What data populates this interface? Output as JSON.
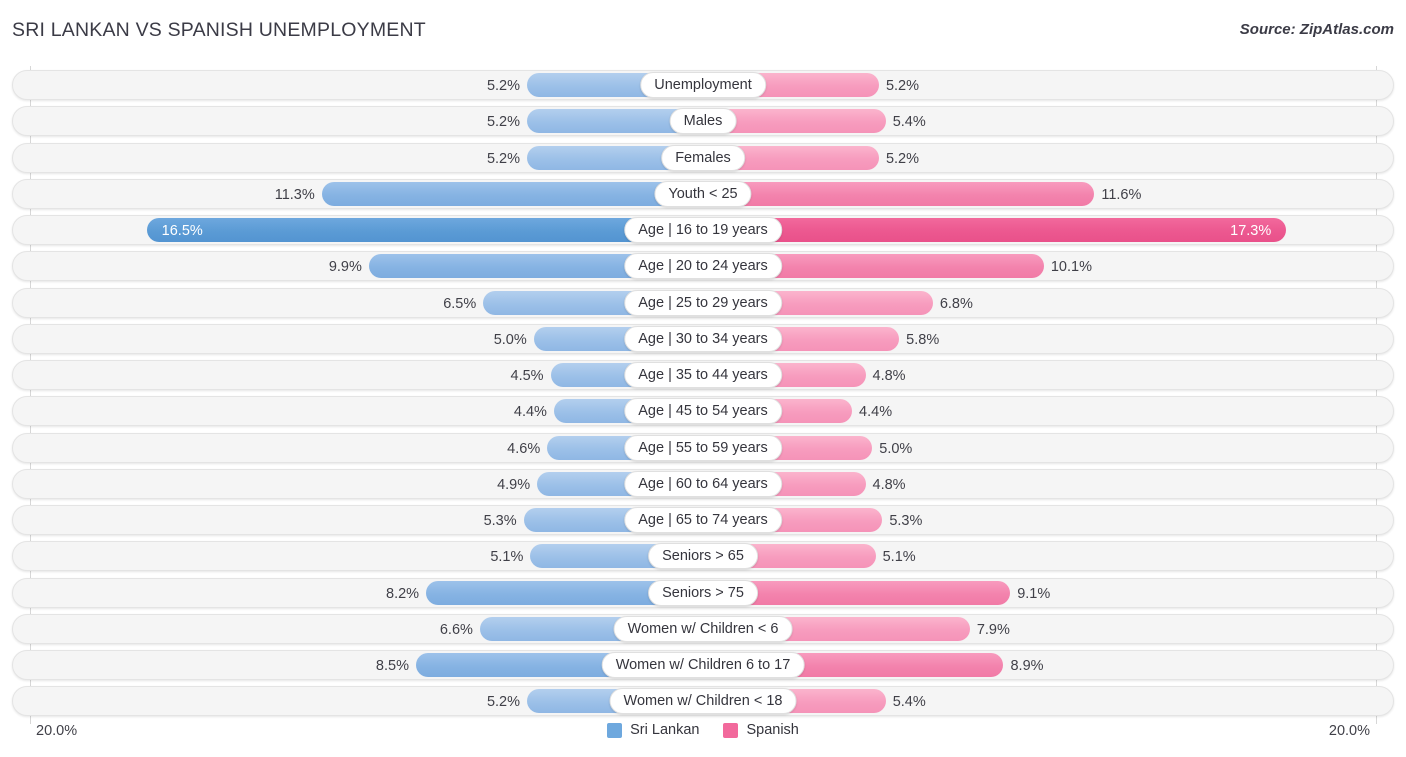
{
  "header": {
    "title": "SRI LANKAN VS SPANISH UNEMPLOYMENT",
    "source": "Source: ZipAtlas.com"
  },
  "axis": {
    "left_max_label": "20.0%",
    "right_max_label": "20.0%"
  },
  "legend": {
    "items": [
      {
        "label": "Sri Lankan",
        "color": "#6ea8de"
      },
      {
        "label": "Spanish",
        "color": "#f2699c"
      }
    ]
  },
  "chart_data": {
    "type": "bar",
    "orientation": "horizontal-diverging",
    "title": "SRI LANKAN VS SPANISH UNEMPLOYMENT",
    "xlabel": "",
    "ylabel": "",
    "xlim": [
      0,
      20
    ],
    "axis_max": 20.0,
    "grid": true,
    "legend_position": "bottom-center",
    "series": [
      {
        "name": "Sri Lankan",
        "color": "#6ea8de",
        "side": "left",
        "values": [
          5.2,
          5.2,
          5.2,
          11.3,
          16.5,
          9.9,
          6.5,
          5.0,
          4.5,
          4.4,
          4.6,
          4.9,
          5.3,
          5.1,
          8.2,
          6.6,
          8.5,
          5.2
        ]
      },
      {
        "name": "Spanish",
        "color": "#f2699c",
        "side": "right",
        "values": [
          5.2,
          5.4,
          5.2,
          11.6,
          17.3,
          10.1,
          6.8,
          5.8,
          4.8,
          4.4,
          5.0,
          4.8,
          5.3,
          5.1,
          9.1,
          7.9,
          8.9,
          5.4
        ]
      }
    ],
    "categories": [
      "Unemployment",
      "Males",
      "Females",
      "Youth < 25",
      "Age | 16 to 19 years",
      "Age | 20 to 24 years",
      "Age | 25 to 29 years",
      "Age | 30 to 34 years",
      "Age | 35 to 44 years",
      "Age | 45 to 54 years",
      "Age | 55 to 59 years",
      "Age | 60 to 64 years",
      "Age | 65 to 74 years",
      "Seniors > 65",
      "Seniors > 75",
      "Women w/ Children < 6",
      "Women w/ Children 6 to 17",
      "Women w/ Children < 18"
    ],
    "rows": [
      {
        "label": "Unemployment",
        "left": 5.2,
        "left_label": "5.2%",
        "right": 5.2,
        "right_label": "5.2%",
        "emphasis": "normal"
      },
      {
        "label": "Males",
        "left": 5.2,
        "left_label": "5.2%",
        "right": 5.4,
        "right_label": "5.4%",
        "emphasis": "normal"
      },
      {
        "label": "Females",
        "left": 5.2,
        "left_label": "5.2%",
        "right": 5.2,
        "right_label": "5.2%",
        "emphasis": "normal"
      },
      {
        "label": "Youth < 25",
        "left": 11.3,
        "left_label": "11.3%",
        "right": 11.6,
        "right_label": "11.6%",
        "emphasis": "mid"
      },
      {
        "label": "Age | 16 to 19 years",
        "left": 16.5,
        "left_label": "16.5%",
        "right": 17.3,
        "right_label": "17.3%",
        "emphasis": "hi"
      },
      {
        "label": "Age | 20 to 24 years",
        "left": 9.9,
        "left_label": "9.9%",
        "right": 10.1,
        "right_label": "10.1%",
        "emphasis": "mid"
      },
      {
        "label": "Age | 25 to 29 years",
        "left": 6.5,
        "left_label": "6.5%",
        "right": 6.8,
        "right_label": "6.8%",
        "emphasis": "normal"
      },
      {
        "label": "Age | 30 to 34 years",
        "left": 5.0,
        "left_label": "5.0%",
        "right": 5.8,
        "right_label": "5.8%",
        "emphasis": "normal"
      },
      {
        "label": "Age | 35 to 44 years",
        "left": 4.5,
        "left_label": "4.5%",
        "right": 4.8,
        "right_label": "4.8%",
        "emphasis": "normal"
      },
      {
        "label": "Age | 45 to 54 years",
        "left": 4.4,
        "left_label": "4.4%",
        "right": 4.4,
        "right_label": "4.4%",
        "emphasis": "normal"
      },
      {
        "label": "Age | 55 to 59 years",
        "left": 4.6,
        "left_label": "4.6%",
        "right": 5.0,
        "right_label": "5.0%",
        "emphasis": "normal"
      },
      {
        "label": "Age | 60 to 64 years",
        "left": 4.9,
        "left_label": "4.9%",
        "right": 4.8,
        "right_label": "4.8%",
        "emphasis": "normal"
      },
      {
        "label": "Age | 65 to 74 years",
        "left": 5.3,
        "left_label": "5.3%",
        "right": 5.3,
        "right_label": "5.3%",
        "emphasis": "normal"
      },
      {
        "label": "Seniors > 65",
        "left": 5.1,
        "left_label": "5.1%",
        "right": 5.1,
        "right_label": "5.1%",
        "emphasis": "normal"
      },
      {
        "label": "Seniors > 75",
        "left": 8.2,
        "left_label": "8.2%",
        "right": 9.1,
        "right_label": "9.1%",
        "emphasis": "mid"
      },
      {
        "label": "Women w/ Children < 6",
        "left": 6.6,
        "left_label": "6.6%",
        "right": 7.9,
        "right_label": "7.9%",
        "emphasis": "normal"
      },
      {
        "label": "Women w/ Children 6 to 17",
        "left": 8.5,
        "left_label": "8.5%",
        "right": 8.9,
        "right_label": "8.9%",
        "emphasis": "mid"
      },
      {
        "label": "Women w/ Children < 18",
        "left": 5.2,
        "left_label": "5.2%",
        "right": 5.4,
        "right_label": "5.4%",
        "emphasis": "normal"
      }
    ]
  }
}
